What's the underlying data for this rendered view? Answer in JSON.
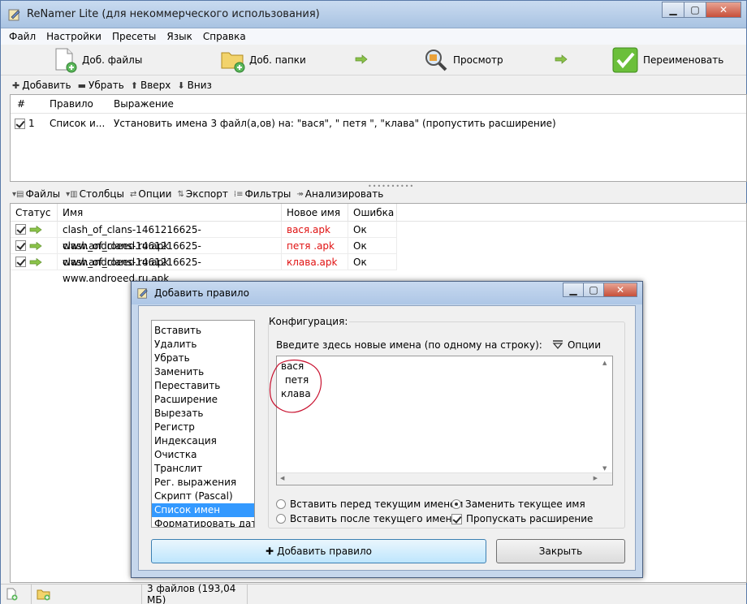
{
  "window": {
    "title": "ReNamer Lite (для некоммерческого использования)"
  },
  "menu": [
    "Файл",
    "Настройки",
    "Пресеты",
    "Язык",
    "Справка"
  ],
  "toolbar": {
    "add_files": "Доб. файлы",
    "add_folders": "Доб. папки",
    "preview": "Просмотр",
    "rename": "Переименовать"
  },
  "rules_toolbar": {
    "add": "Добавить",
    "remove": "Убрать",
    "up": "Вверх",
    "down": "Вниз"
  },
  "rules_table": {
    "headers": [
      "#",
      "Правило",
      "Выражение"
    ],
    "rows": [
      {
        "num": "1",
        "rule": "Список и...",
        "expression": "Установить имена 3 файл(а,ов) на: \"вася\", \" петя \", \"клава\" (пропустить расширение)"
      }
    ]
  },
  "files_toolbar": [
    "Файлы",
    "Столбцы",
    "Опции",
    "Экспорт",
    "Фильтры",
    "Анализировать"
  ],
  "files_table": {
    "headers": [
      "Статус",
      "Имя",
      "Новое имя",
      "Ошибка"
    ],
    "rows": [
      {
        "name": "clash_of_clans-1461216625-www.androeed.ru.apk",
        "new_name": "вася.apk",
        "error": "Ок"
      },
      {
        "name": "clash_of_clans-1461216625-www.androeed.ru.apk",
        "new_name": " петя .apk",
        "error": "Ок"
      },
      {
        "name": "clash_of_clans-1461216625-www.androeed.ru.apk",
        "new_name": "клава.apk",
        "error": "Ок"
      }
    ]
  },
  "status_bar": {
    "summary": "3 файлов (193,04 МБ)"
  },
  "dialog": {
    "title": "Добавить правило",
    "rules": [
      "Вставить",
      "Удалить",
      "Убрать",
      "Заменить",
      "Переставить",
      "Расширение",
      "Вырезать",
      "Регистр",
      "Индексация",
      "Очистка",
      "Транслит",
      "Рег. выражения",
      "Скрипт (Pascal)",
      "Список имен",
      "Форматировать дату"
    ],
    "selected_rule": "Список имен",
    "config_label": "Конфигурация:",
    "hint": "Введите здесь новые имена (по одному на строку):",
    "options_label": "Опции",
    "names": [
      "вася",
      " петя",
      "клава"
    ],
    "insert_before": "Вставить перед текущим именем",
    "insert_after": "Вставить после текущего имени",
    "replace_current": "Заменить текущее имя",
    "skip_extension": "Пропускать расширение",
    "add_button": "Добавить правило",
    "close_button": "Закрыть"
  },
  "colors": {
    "new_name": "#e01010",
    "selection": "#3399ff",
    "annotation": "#c8102e"
  }
}
